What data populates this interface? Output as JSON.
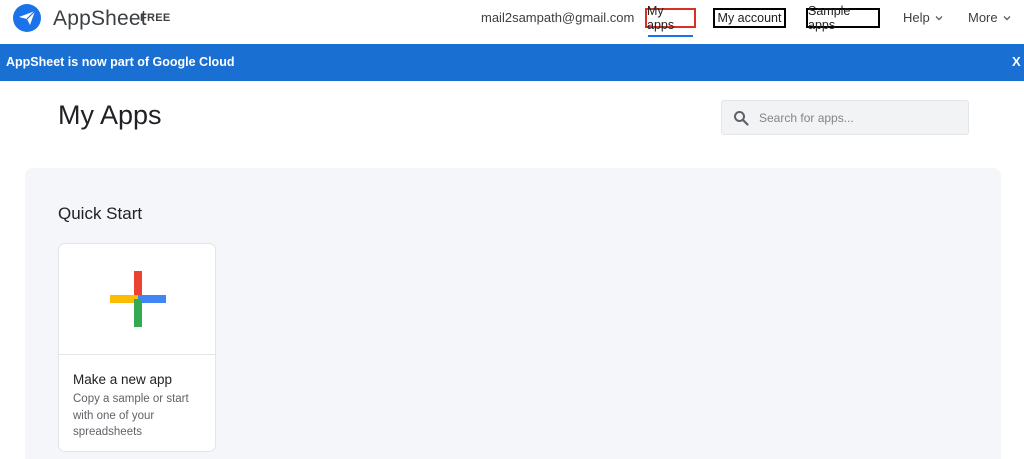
{
  "header": {
    "brand": "AppSheet",
    "plan_tag": "FREE",
    "user_email": "mail2sampath@gmail.com",
    "nav": {
      "my_apps": "My apps",
      "my_account": "My account",
      "sample_apps": "Sample apps",
      "help": "Help",
      "more": "More"
    },
    "logo_icon": "paper-plane-icon",
    "chevron_icon": "chevron-down-icon",
    "colors": {
      "brand_blue": "#1a73e8",
      "active_outline": "#d93025",
      "outline": "#000000"
    }
  },
  "banner": {
    "text": "AppSheet is now part of Google Cloud",
    "close_label": "X",
    "color": "#1a6fd3"
  },
  "main": {
    "title": "My Apps",
    "search": {
      "placeholder": "Search for apps...",
      "value": "",
      "icon": "search-icon"
    },
    "quick_start": {
      "title": "Quick Start",
      "cards": [
        {
          "icon": "plus-icon",
          "title": "Make a new app",
          "description": "Copy a sample or start with one of your spreadsheets",
          "colors": {
            "red": "#ea4335",
            "yellow": "#fbbc04",
            "blue": "#4285f4",
            "green": "#34a853"
          }
        }
      ]
    }
  }
}
